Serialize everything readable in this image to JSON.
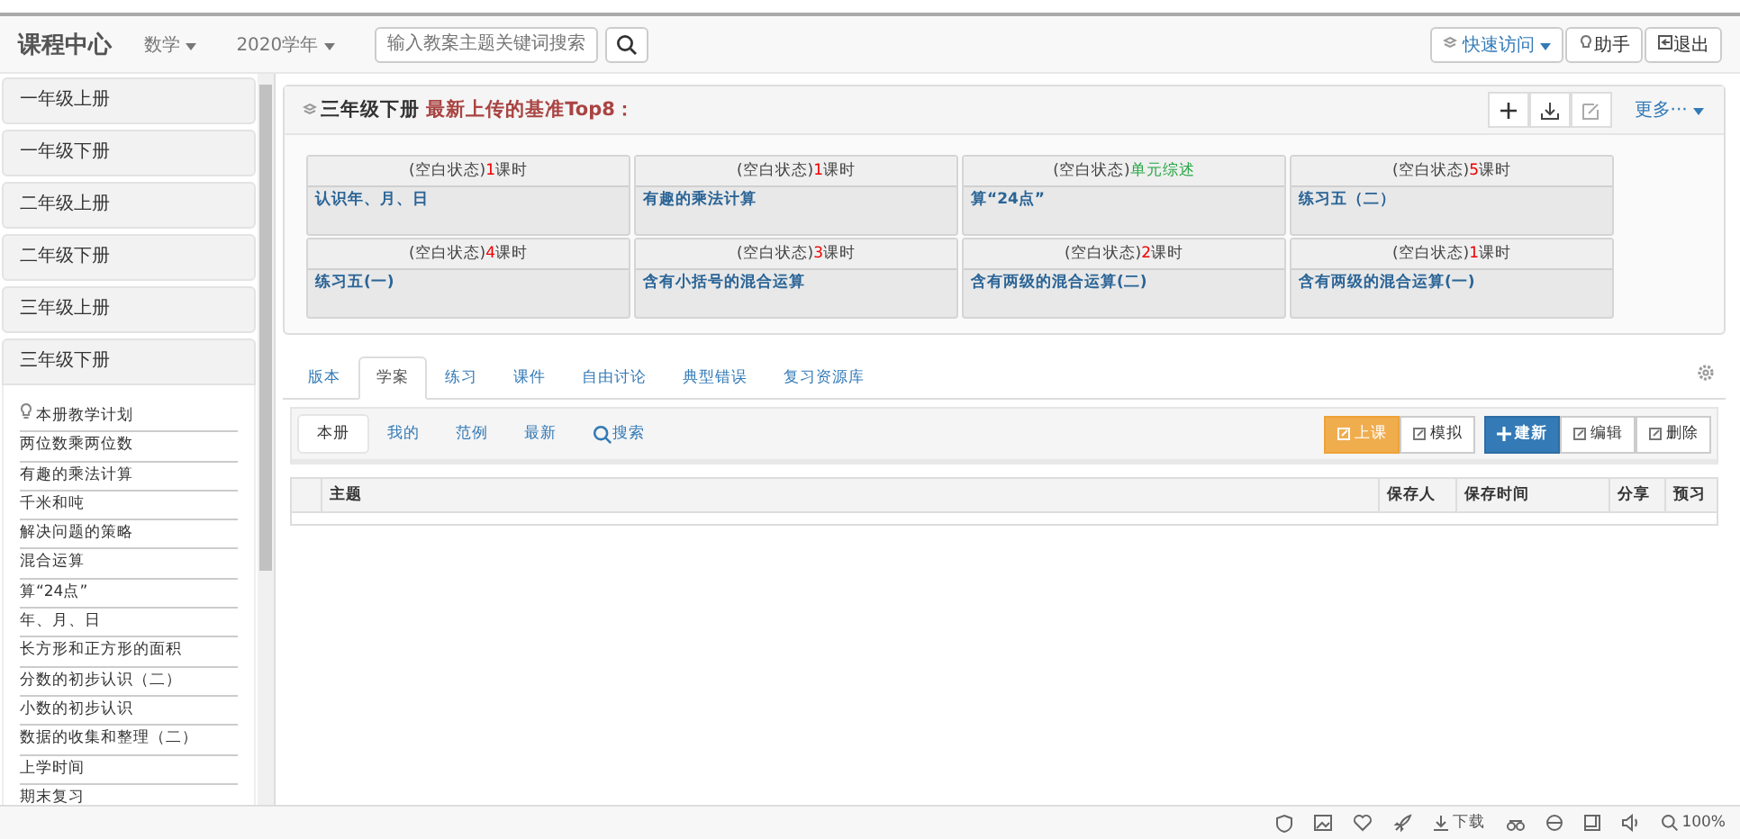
{
  "header": {
    "logo": "课程中心",
    "subject": "数学",
    "year": "2020学年",
    "search": {
      "placeholder": "输入教案主题关键词搜索"
    },
    "quick_access": "快速访问",
    "helper": "助手",
    "logout": "退出"
  },
  "sidebar": {
    "grades": [
      {
        "label": "一年级上册",
        "expanded": false
      },
      {
        "label": "一年级下册",
        "expanded": false
      },
      {
        "label": "二年级上册",
        "expanded": false
      },
      {
        "label": "二年级下册",
        "expanded": false
      },
      {
        "label": "三年级上册",
        "expanded": false
      },
      {
        "label": "三年级下册",
        "expanded": true,
        "children": [
          {
            "label": "本册教学计划",
            "kind": "plan"
          },
          {
            "label": "两位数乘两位数",
            "kind": "unit"
          },
          {
            "label": "有趣的乘法计算",
            "kind": "unit"
          },
          {
            "label": "千米和吨",
            "kind": "unit"
          },
          {
            "label": "解决问题的策略",
            "kind": "unit"
          },
          {
            "label": "混合运算",
            "kind": "unit"
          },
          {
            "label": "算“24点”",
            "kind": "unit"
          },
          {
            "label": "年、月、日",
            "kind": "unit"
          },
          {
            "label": "长方形和正方形的面积",
            "kind": "unit"
          },
          {
            "label": "分数的初步认识（二）",
            "kind": "unit"
          },
          {
            "label": "小数的初步认识",
            "kind": "unit"
          },
          {
            "label": "数据的收集和整理（二）",
            "kind": "unit"
          },
          {
            "label": "上学时间",
            "kind": "unit"
          },
          {
            "label": "期末复习",
            "kind": "unit"
          }
        ]
      }
    ]
  },
  "top_panel": {
    "grade": "三年级下册",
    "title": "最新上传的基准Top8：",
    "more": "更多···",
    "cards": [
      {
        "status": "(空白状态)",
        "kind": "lessons",
        "count": "1",
        "unit": "课时",
        "title": "认识年、月、日"
      },
      {
        "status": "(空白状态)",
        "kind": "lessons",
        "count": "1",
        "unit": "课时",
        "title": "有趣的乘法计算"
      },
      {
        "status": "(空白状态)",
        "kind": "summary",
        "unit": "单元综述",
        "title": "算“24点”"
      },
      {
        "status": "(空白状态)",
        "kind": "lessons",
        "count": "5",
        "unit": "课时",
        "title": "练习五（二）"
      },
      {
        "status": "(空白状态)",
        "kind": "lessons",
        "count": "4",
        "unit": "课时",
        "title": "练习五(一)"
      },
      {
        "status": "(空白状态)",
        "kind": "lessons",
        "count": "3",
        "unit": "课时",
        "title": "含有小括号的混合运算"
      },
      {
        "status": "(空白状态)",
        "kind": "lessons",
        "count": "2",
        "unit": "课时",
        "title": "含有两级的混合运算(二)"
      },
      {
        "status": "(空白状态)",
        "kind": "lessons",
        "count": "1",
        "unit": "课时",
        "title": "含有两级的混合运算(一)"
      }
    ]
  },
  "tabs": [
    {
      "label": "版本",
      "selected": false
    },
    {
      "label": "学案",
      "selected": true
    },
    {
      "label": "练习",
      "selected": false
    },
    {
      "label": "课件",
      "selected": false
    },
    {
      "label": "自由讨论",
      "selected": false
    },
    {
      "label": "典型错误",
      "selected": false
    },
    {
      "label": "复习资源库",
      "selected": false
    }
  ],
  "sub_tabs": [
    {
      "label": "本册",
      "selected": true,
      "kind": "tab"
    },
    {
      "label": "我的",
      "selected": false,
      "kind": "tab"
    },
    {
      "label": "范例",
      "selected": false,
      "kind": "tab"
    },
    {
      "label": "最新",
      "selected": false,
      "kind": "tab"
    },
    {
      "label": "搜索",
      "selected": false,
      "kind": "search"
    }
  ],
  "actions": [
    {
      "label": "上课",
      "kind": "warning"
    },
    {
      "label": "模拟",
      "kind": "default"
    },
    {
      "label": "建新",
      "kind": "primary"
    },
    {
      "label": "编辑",
      "kind": "default"
    },
    {
      "label": "删除",
      "kind": "default"
    }
  ],
  "table": {
    "columns": [
      "主题",
      "保存人",
      "保存时间",
      "分享",
      "预习"
    ]
  },
  "status_bar": {
    "download": "下载",
    "zoom": "100%"
  }
}
